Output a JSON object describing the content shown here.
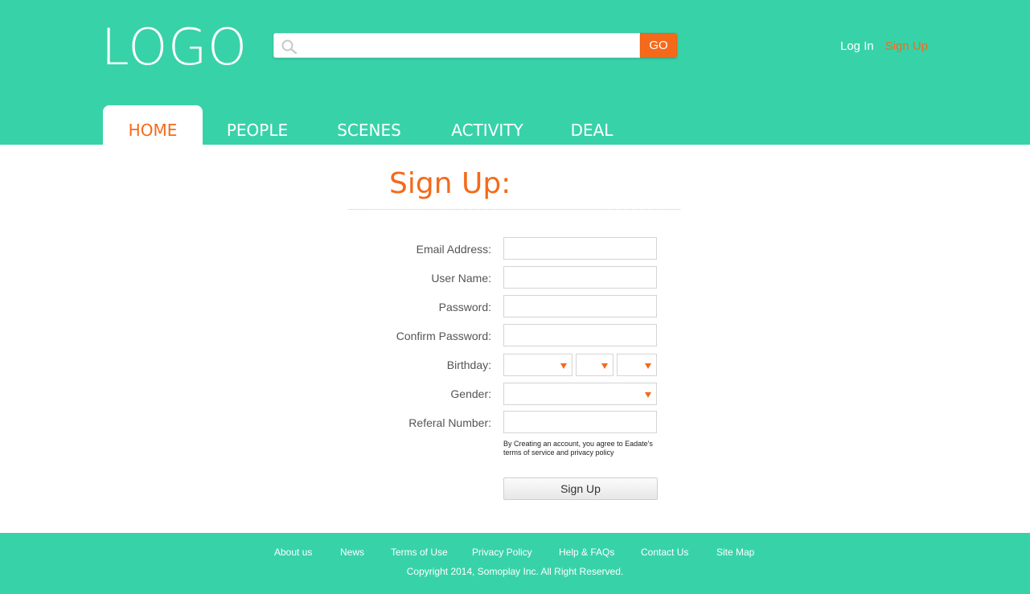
{
  "brand": {
    "logo_text": "LOGO"
  },
  "colors": {
    "primary": "#38d2a9",
    "accent": "#f46a1a",
    "text": "#555555"
  },
  "search": {
    "placeholder": "",
    "value": "",
    "icon": "search-icon",
    "go_label": "GO"
  },
  "auth": {
    "login_label": "Log In",
    "signup_label": "Sign Up"
  },
  "nav": {
    "active": "HOME",
    "tabs": [
      {
        "label": "HOME"
      },
      {
        "label": "PEOPLE"
      },
      {
        "label": "SCENES"
      },
      {
        "label": "ACTIVITY"
      },
      {
        "label": "DEAL"
      }
    ]
  },
  "form": {
    "title": "Sign Up:",
    "fields": {
      "email": {
        "label": "Email Address:",
        "value": ""
      },
      "username": {
        "label": "User Name:",
        "value": ""
      },
      "password": {
        "label": "Password:",
        "value": ""
      },
      "confirm_password": {
        "label": "Confirm Password:",
        "value": ""
      },
      "birthday": {
        "label": "Birthday:",
        "month": "",
        "day": "",
        "year": ""
      },
      "gender": {
        "label": "Gender:",
        "value": ""
      },
      "referral": {
        "label": "Referal Number:",
        "value": ""
      }
    },
    "terms_text": "By Creating an account, you agree to Eadate's terms of service and privacy policy",
    "submit_label": "Sign Up"
  },
  "footer": {
    "links": [
      "About us",
      "News",
      "Terms of Use",
      "Privacy Policy",
      "Help & FAQs",
      "Contact Us",
      "Site Map"
    ],
    "copyright": "Copyright 2014, Somoplay Inc. All Right Reserved."
  }
}
